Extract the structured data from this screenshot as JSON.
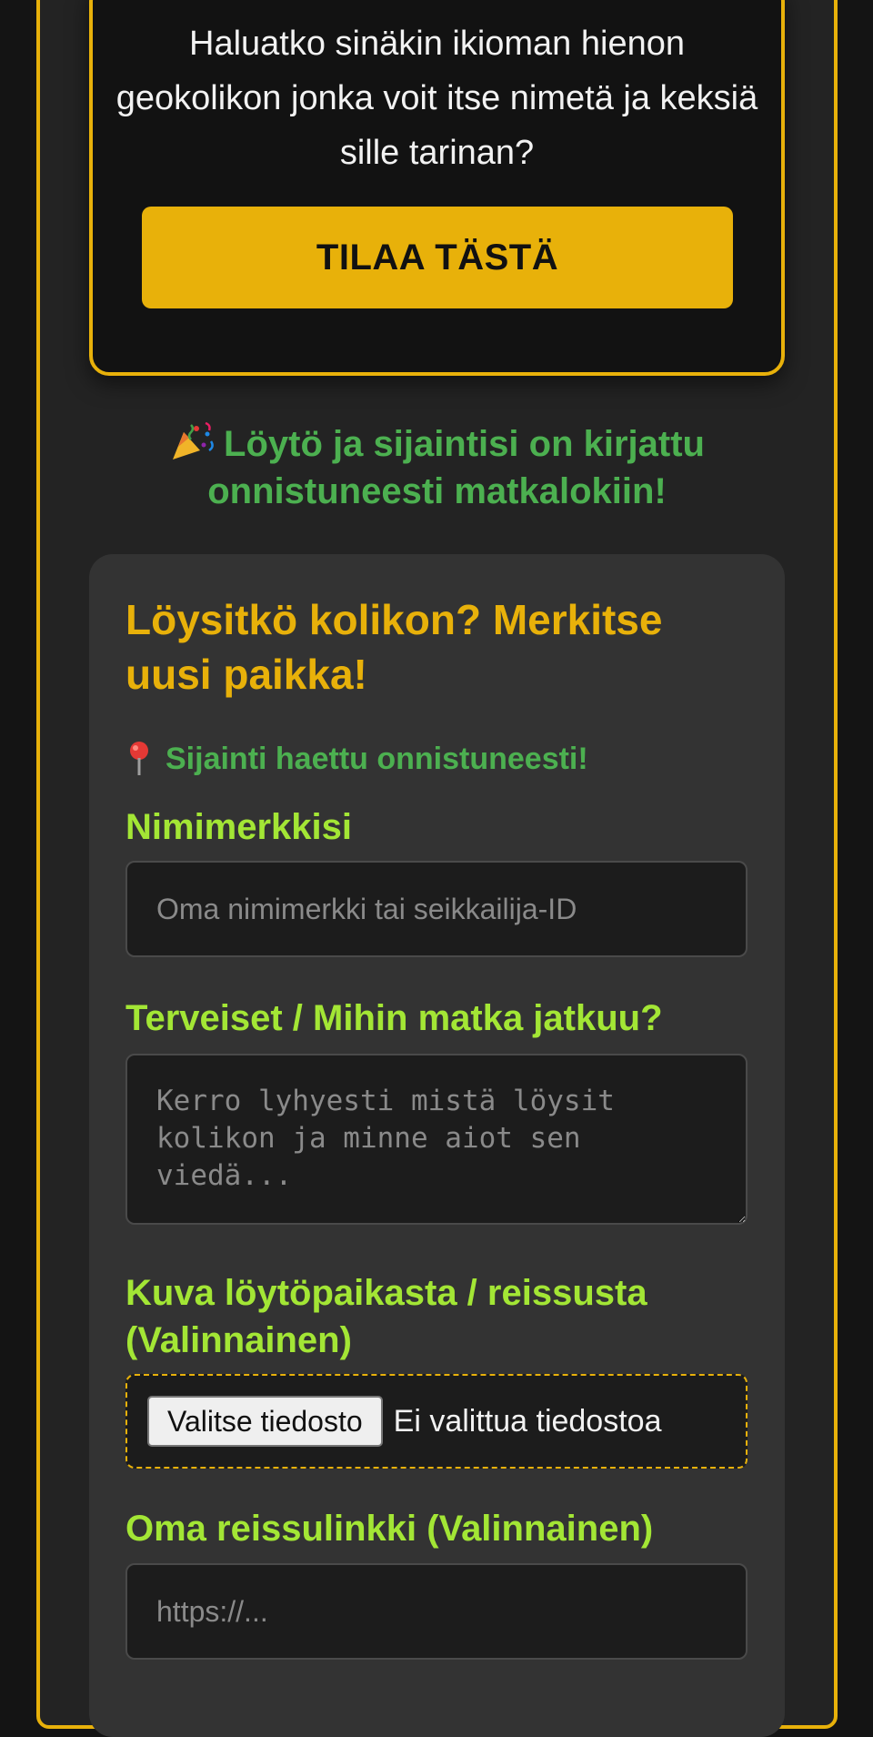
{
  "promo": {
    "text": "Haluatko sinäkin ikioman hienon geokolikon jonka voit itse nimetä ja keksiä sille tarinan?",
    "order_button": "TILAA TÄSTÄ"
  },
  "success_message": "Löytö ja sijaintisi on kirjattu onnistuneesti matkalokiin!",
  "form": {
    "title": "Löysitkö kolikon? Merkitse uusi paikka!",
    "location_status": "Sijainti haettu onnistuneesti!",
    "nickname": {
      "label": "Nimimerkkisi",
      "placeholder": "Oma nimimerkki tai seikkailija-ID",
      "value": ""
    },
    "greetings": {
      "label": "Terveiset / Mihin matka jatkuu?",
      "placeholder": "Kerro lyhyesti mistä löysit kolikon ja minne aiot sen viedä...",
      "value": ""
    },
    "photo": {
      "label": "Kuva löytöpaikasta / reissusta (Valinnainen)",
      "button": "Valitse tiedosto",
      "status": "Ei valittua tiedostoa"
    },
    "trip_link": {
      "label": "Oma reissulinkki (Valinnainen)",
      "placeholder": "https://...",
      "value": ""
    }
  },
  "icons": {
    "success": "party-popper-icon",
    "location": "pushpin-icon"
  },
  "colors": {
    "accent": "#e8b10a",
    "success": "#4cb050",
    "label": "#a3e635",
    "background": "#141414",
    "card": "#333333"
  }
}
